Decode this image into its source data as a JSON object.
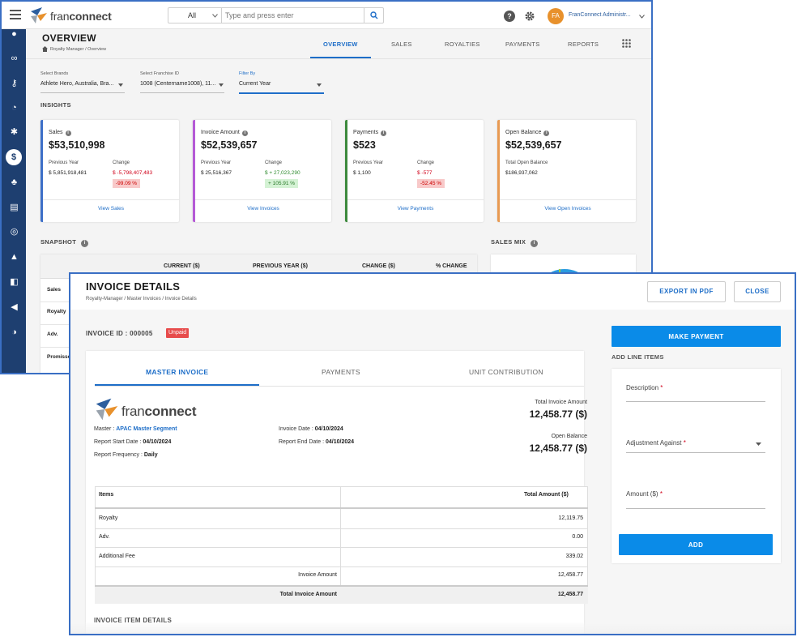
{
  "back_window": {
    "brand": {
      "name": "franconnect"
    },
    "search": {
      "scope": "All",
      "placeholder": "Type and press enter"
    },
    "header_icons": {
      "help": "help-circle-icon",
      "settings": "gear-icon"
    },
    "user": {
      "initials": "FA",
      "name": "FranConnect Administr..."
    },
    "page_title": "OVERVIEW",
    "breadcrumb": "Royalty Manager / Overview",
    "nav_tabs": [
      "OVERVIEW",
      "SALES",
      "ROYALTIES",
      "PAYMENTS",
      "REPORTS"
    ],
    "active_tab": "OVERVIEW",
    "filters": {
      "brands": {
        "label": "Select Brands",
        "value": "Athlete Hero, Australia, Bra..."
      },
      "franchise": {
        "label": "Select Franchise ID",
        "value": "1008 (Centername1008), 11..."
      },
      "filter_by": {
        "label": "Filter By",
        "value": "Current Year"
      }
    },
    "insights_label": "INSIGHTS",
    "cards": [
      {
        "label": "Sales",
        "value": "$53,510,998",
        "prev_label": "Previous Year",
        "prev_value": "$ 5,851,918,481",
        "change_label": "Change",
        "change_value": "$ -5,798,407,483",
        "change_pct": "-99.09 %",
        "link": "View Sales",
        "color": "#3d6fc8",
        "trend": "down"
      },
      {
        "label": "Invoice Amount",
        "value": "$52,539,657",
        "prev_label": "Previous Year",
        "prev_value": "$ 25,516,367",
        "change_label": "Change",
        "change_value": "$ + 27,023,290",
        "change_pct": "+ 105.91 %",
        "link": "View Invoices",
        "color": "#b55ad6",
        "trend": "up"
      },
      {
        "label": "Payments",
        "value": "$523",
        "prev_label": "Previous Year",
        "prev_value": "$ 1,100",
        "change_label": "Change",
        "change_value": "$ -577",
        "change_pct": "-52.45 %",
        "link": "View Payments",
        "color": "#3d8a3d",
        "trend": "down"
      },
      {
        "label": "Open Balance",
        "value": "$52,539,657",
        "prev_label": "Total Open Balance",
        "prev_value": "$186,937,062",
        "link": "View Open Invoices",
        "color": "#e89a52"
      }
    ],
    "snapshot": {
      "label": "SNAPSHOT",
      "columns": [
        "CURRENT ($)",
        "PREVIOUS YEAR ($)",
        "CHANGE ($)",
        "% CHANGE"
      ],
      "rows": [
        "Sales",
        "Royalty",
        "Adv.",
        "Promisso"
      ]
    },
    "sales_mix_label": "SALES MIX"
  },
  "invoice": {
    "title": "INVOICE DETAILS",
    "breadcrumb": "Royalty-Manager / Master Invoices / Invoice Details",
    "export_label": "EXPORT IN PDF",
    "close_label": "CLOSE",
    "id_label": "INVOICE ID : 000005",
    "status": "Unpaid",
    "tabs": [
      "MASTER INVOICE",
      "PAYMENTS",
      "UNIT CONTRIBUTION"
    ],
    "active_tab": "MASTER INVOICE",
    "brand": "franconnect",
    "master_label": "Master : ",
    "master_value": "APAC Master Segment",
    "invoice_date_label": "Invoice Date : ",
    "invoice_date": "04/10/2024",
    "report_start_label": "Report Start Date : ",
    "report_start": "04/10/2024",
    "report_end_label": "Report End Date : ",
    "report_end": "04/10/2024",
    "frequency_label": "Report Frequency : ",
    "frequency": "Daily",
    "total_label": "Total Invoice Amount",
    "total_value": "12,458.77 ($)",
    "open_label": "Open Balance",
    "open_value": "12,458.77 ($)",
    "table": {
      "headers": [
        "Items",
        "Total Amount ($)"
      ],
      "rows": [
        {
          "item": "Royalty",
          "amount": "12,119.75"
        },
        {
          "item": "Adv.",
          "amount": "0.00"
        },
        {
          "item": "Additional Fee",
          "amount": "339.02"
        }
      ],
      "subtotal_label": "Invoice Amount",
      "subtotal_value": "12,458.77",
      "total_label": "Total Invoice Amount",
      "total_value": "12,458.77"
    },
    "item_details_label": "INVOICE ITEM DETAILS",
    "make_payment_label": "MAKE PAYMENT",
    "add_line_items_label": "ADD LINE ITEMS",
    "form": {
      "description_label": "Description",
      "adjustment_label": "Adjustment Against",
      "amount_label": "Amount ($)",
      "add_label": "ADD"
    }
  }
}
